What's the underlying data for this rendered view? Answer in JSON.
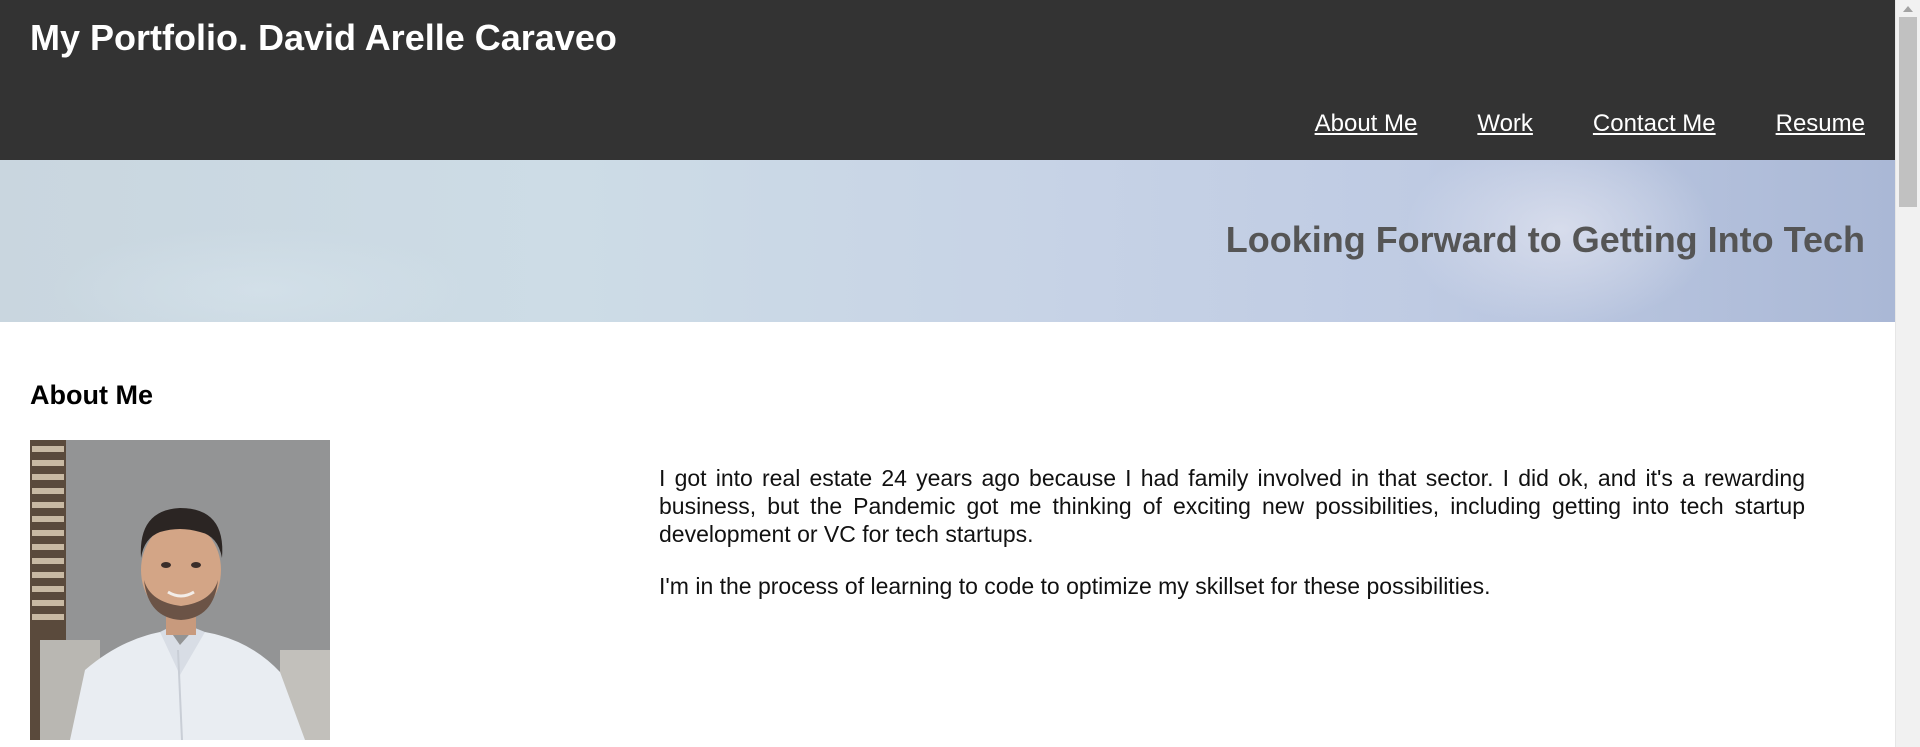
{
  "header": {
    "title": "My Portfolio. David Arelle Caraveo",
    "nav": [
      {
        "label": "About Me"
      },
      {
        "label": "Work"
      },
      {
        "label": "Contact Me"
      },
      {
        "label": "Resume"
      }
    ]
  },
  "hero": {
    "text": "Looking Forward to Getting Into Tech"
  },
  "about": {
    "heading": "About Me",
    "photo_icon": "portrait-photo",
    "paragraphs": [
      "I got into real estate 24 years ago because I had family involved in that sector. I did ok, and it's a rewarding business, but the Pandemic got me thinking of exciting new possibilities, including getting into tech startup development or VC for tech startups.",
      "I'm in the process of learning to code to optimize my skillset for these possibilities."
    ]
  },
  "colors": {
    "header_bg": "#333333",
    "header_text": "#ffffff",
    "hero_text": "#555555"
  }
}
